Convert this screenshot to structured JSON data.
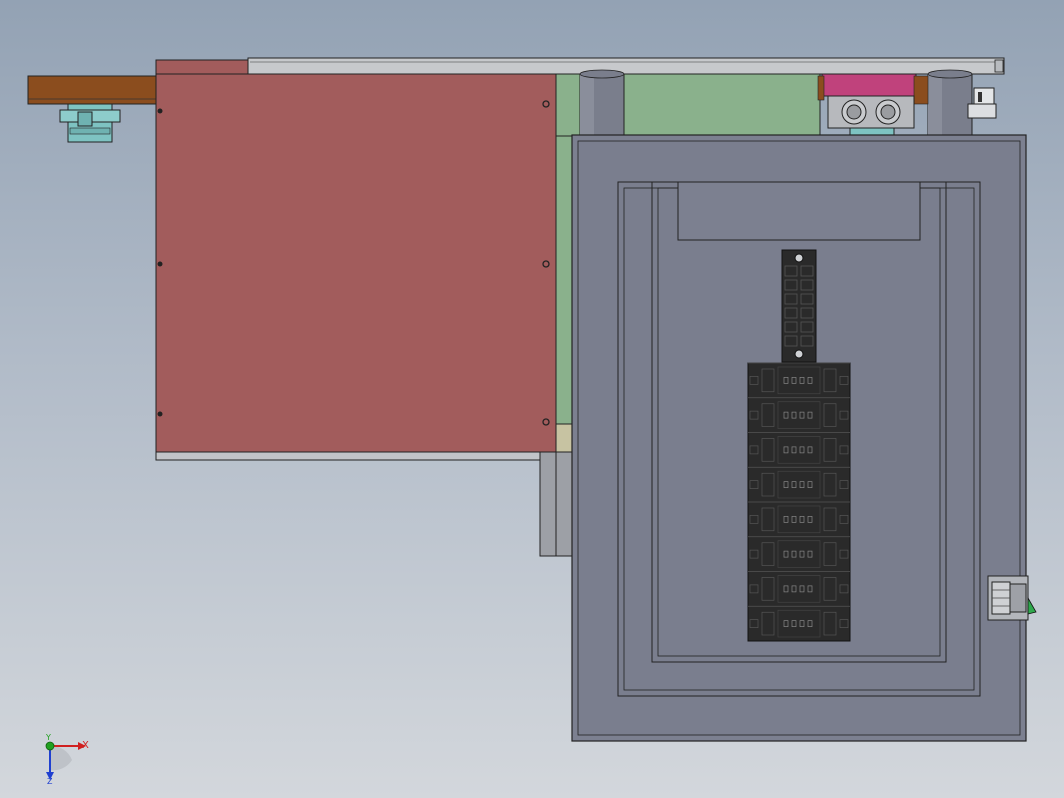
{
  "viewport": {
    "background_top": "#93a2b4",
    "background_bottom": "#d3d7dc"
  },
  "model": {
    "cover_plate_color": "#a25c5c",
    "enclosure_color": "#7c8090",
    "green_panel_color": "#8ab18c",
    "bracket_color": "#8b4d1e",
    "mount_color": "#7ec3c2",
    "connector_color": "#c0427c",
    "standoff_color": "#7a7e8c",
    "terminal_block_color": "#2a2a2a",
    "switch_color": "#2fa84d",
    "terminal_rows": 8
  },
  "triad": {
    "x_label": "X",
    "y_label": "Y",
    "z_label": "Z",
    "x_color": "#d02020",
    "y_color": "#20a020",
    "z_color": "#2040d0"
  }
}
